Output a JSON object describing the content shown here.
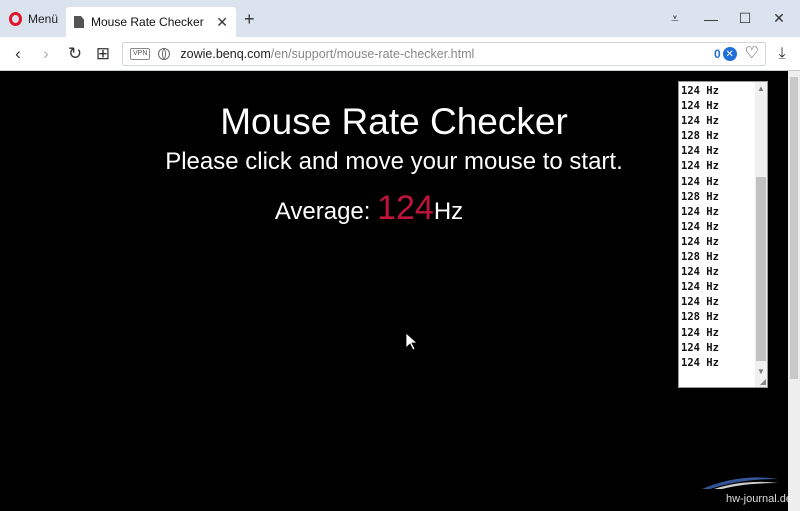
{
  "browser": {
    "menu_label": "Menü",
    "tab_title": "Mouse Rate Checker",
    "new_tab_symbol": "+",
    "tab_close_symbol": "✕",
    "window_controls": {
      "tabs_menu": "⩡",
      "minimize": "—",
      "maximize": "☐",
      "close": "✕"
    },
    "nav": {
      "back": "‹",
      "forward": "›",
      "reload": "↻",
      "speed_dial": "⊞"
    },
    "address": {
      "vpn_label": "VPN",
      "url_host": "zowie.benq.com",
      "url_path": "/en/support/mouse-rate-checker.html",
      "blocked_count": "0",
      "adblock_symbol": "✕",
      "heart_symbol": "♡"
    },
    "download_symbol": "⤓",
    "accent_color": "#e0162b",
    "adblock_color": "#1e6fd9"
  },
  "page": {
    "title": "Mouse Rate Checker",
    "subtitle": "Please click and move your mouse to start.",
    "average_label": "Average: ",
    "average_value": "124",
    "average_unit": "Hz",
    "value_color": "#c0143c",
    "rate_log": [
      "124 Hz",
      "124 Hz",
      "124 Hz",
      "128 Hz",
      "124 Hz",
      "124 Hz",
      "124 Hz",
      "128 Hz",
      "124 Hz",
      "124 Hz",
      "124 Hz",
      "128 Hz",
      "124 Hz",
      "124 Hz",
      "124 Hz",
      "128 Hz",
      "124 Hz",
      "124 Hz",
      "124 Hz"
    ]
  },
  "watermark": "hw-journal.de"
}
